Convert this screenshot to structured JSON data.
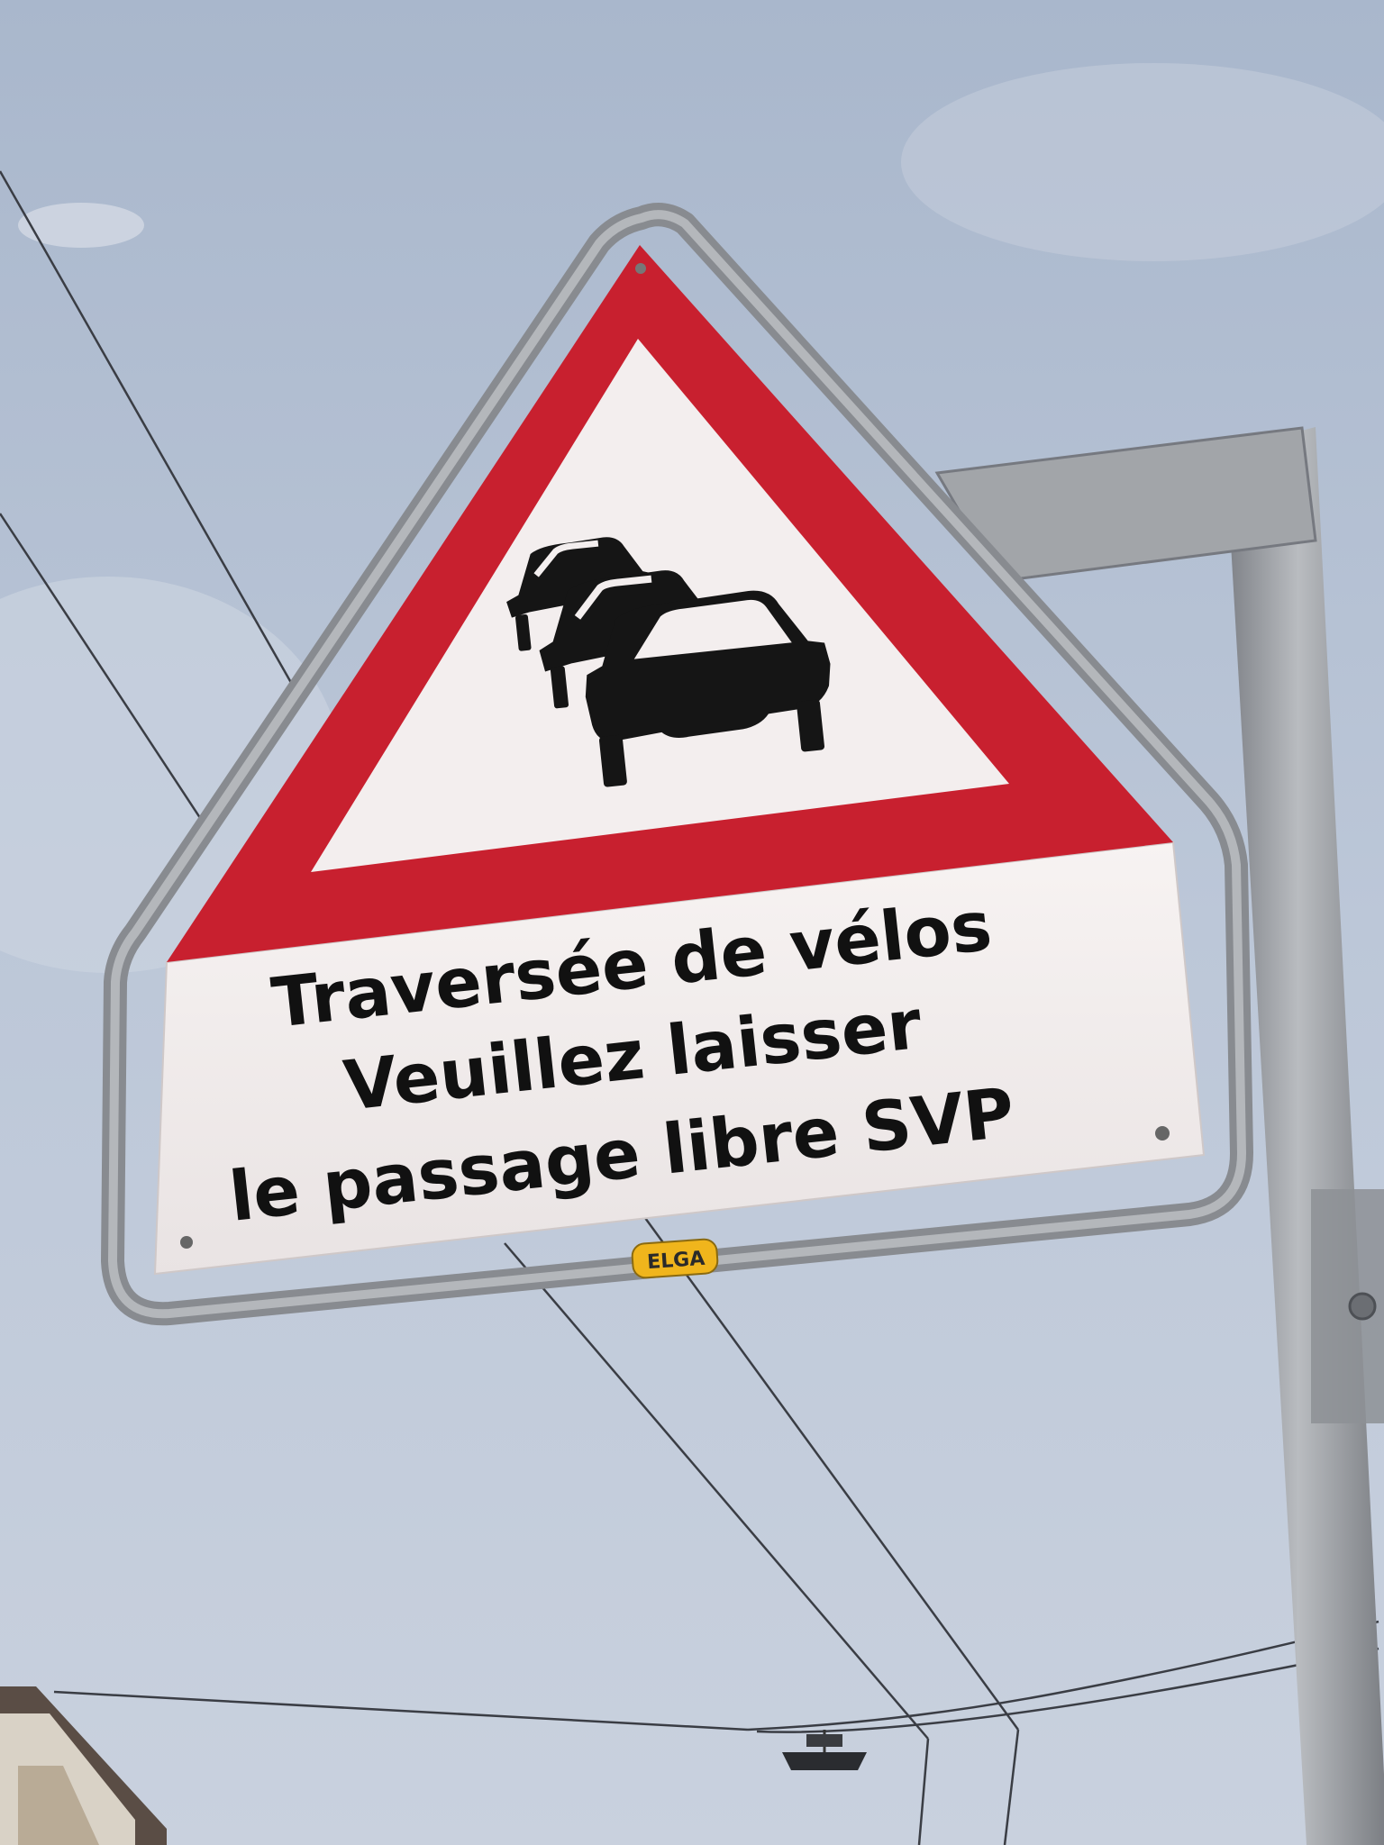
{
  "sign": {
    "type": "warning-triangle-traffic-queue",
    "border_color": "#c8202f",
    "background_color": "#f3eeee",
    "symbol_icon": "traffic-queue-cars-icon",
    "text_lines": [
      "Traversée de vélos",
      "Veuillez laisser",
      "le passage libre SVP"
    ],
    "manufacturer_plate": "ELGA"
  },
  "colors": {
    "sky": "#b7c3d6",
    "metal": "#9c9fa3",
    "symbol": "#151515",
    "plate": "#f0b51c"
  }
}
